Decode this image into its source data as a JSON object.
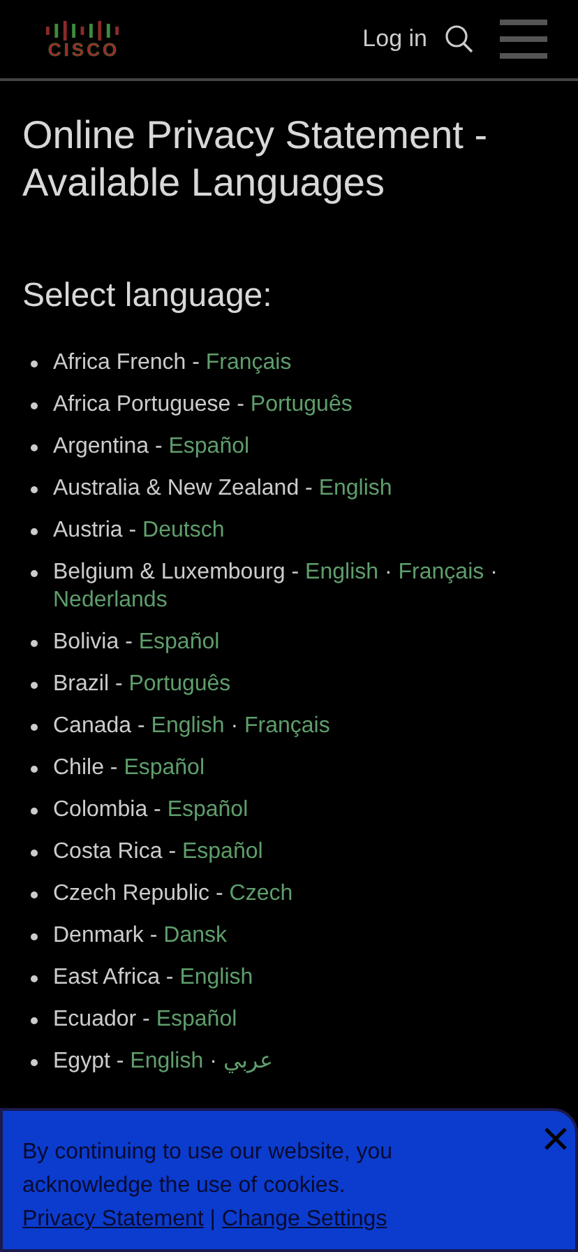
{
  "header": {
    "logo_text": "CISCO",
    "login": "Log in"
  },
  "title": "Online Privacy Statement - Available Languages",
  "subtitle": "Select language:",
  "countries": [
    {
      "name": "Africa French -",
      "languages": [
        {
          "kind": "link",
          "text": "Français"
        }
      ]
    },
    {
      "name": "Africa Portuguese -",
      "languages": [
        {
          "kind": "link",
          "text": "Português"
        }
      ]
    },
    {
      "name": "Argentina -",
      "languages": [
        {
          "kind": "link",
          "text": "Español"
        }
      ]
    },
    {
      "name": "Australia & New Zealand -",
      "languages": [
        {
          "kind": "link",
          "text": "English"
        }
      ]
    },
    {
      "name": "Austria -",
      "languages": [
        {
          "kind": "link",
          "text": "Deutsch"
        }
      ]
    },
    {
      "name": "Belgium & Luxembourg -",
      "languages": [
        {
          "kind": "link",
          "text": "English"
        },
        {
          "kind": "separator",
          "text": "·"
        },
        {
          "kind": "link",
          "text": "Français"
        },
        {
          "kind": "separator",
          "text": "·"
        },
        {
          "kind": "link",
          "text": "Nederlands"
        }
      ]
    },
    {
      "name": "Bolivia -",
      "languages": [
        {
          "kind": "link",
          "text": "Español"
        }
      ]
    },
    {
      "name": "Brazil -",
      "languages": [
        {
          "kind": "link",
          "text": "Português"
        }
      ]
    },
    {
      "name": "Canada -",
      "languages": [
        {
          "kind": "link",
          "text": "English"
        },
        {
          "kind": "separator",
          "text": "·"
        },
        {
          "kind": "link",
          "text": "Français"
        }
      ]
    },
    {
      "name": "Chile -",
      "languages": [
        {
          "kind": "link",
          "text": "Español"
        }
      ]
    },
    {
      "name": "Colombia -",
      "languages": [
        {
          "kind": "link",
          "text": "Español"
        }
      ]
    },
    {
      "name": "Costa Rica -",
      "languages": [
        {
          "kind": "link",
          "text": "Español"
        }
      ]
    },
    {
      "name": "Czech Republic -",
      "languages": [
        {
          "kind": "link",
          "text": "Czech"
        }
      ]
    },
    {
      "name": "Denmark -",
      "languages": [
        {
          "kind": "link",
          "text": "Dansk"
        }
      ]
    },
    {
      "name": "East Africa -",
      "languages": [
        {
          "kind": "link",
          "text": "English"
        }
      ]
    },
    {
      "name": "Ecuador -",
      "languages": [
        {
          "kind": "link",
          "text": "Español"
        }
      ]
    },
    {
      "name": "Egypt -",
      "languages": [
        {
          "kind": "link",
          "text": "English"
        },
        {
          "kind": "separator",
          "text": "·"
        },
        {
          "kind": "link",
          "text": "عربي"
        }
      ]
    }
  ],
  "cookie_banner": {
    "text": "By continuing to use our website, you acknowledge the use of cookies.",
    "links": [
      "Privacy Statement",
      "Change Settings"
    ],
    "divider": "|"
  }
}
